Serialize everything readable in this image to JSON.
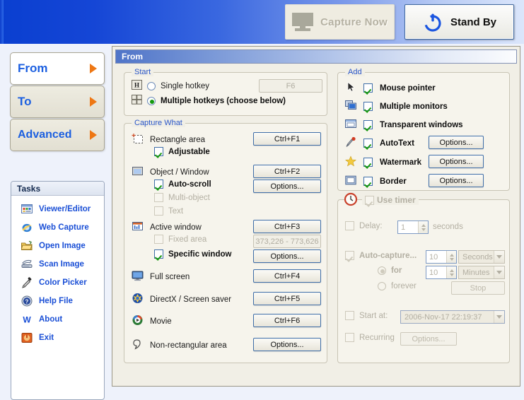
{
  "banner": {
    "capture_now_label": "Capture Now",
    "capture_now_icon": "monitor-icon",
    "capture_now_enabled": false,
    "stand_by_label": "Stand By",
    "stand_by_icon": "power-icon"
  },
  "sidebar": {
    "nav": [
      {
        "label": "From",
        "selected": true,
        "arrow_icon": "arrow-right-icon"
      },
      {
        "label": "To",
        "selected": false,
        "arrow_icon": "arrow-right-icon"
      },
      {
        "label": "Advanced",
        "selected": false,
        "arrow_icon": "arrow-right-icon"
      }
    ],
    "tasks_title": "Tasks",
    "tasks": [
      {
        "label": "Viewer/Editor",
        "icon": "viewer-editor-icon"
      },
      {
        "label": "Web Capture",
        "icon": "internet-explorer-icon"
      },
      {
        "label": "Open Image",
        "icon": "open-folder-icon"
      },
      {
        "label": "Scan Image",
        "icon": "scanner-icon"
      },
      {
        "label": "Color Picker",
        "icon": "eyedropper-icon"
      },
      {
        "label": "Help File",
        "icon": "help-question-icon"
      },
      {
        "label": "About",
        "icon": "letter-w-icon"
      },
      {
        "label": "Exit",
        "icon": "exit-icon"
      }
    ]
  },
  "main": {
    "header_title": "From",
    "start": {
      "legend": "Start",
      "single_hotkey_label": "Single hotkey",
      "single_hotkey_icon": "hotkey-h-icon",
      "single_hotkey_selected": false,
      "single_hotkey_value": "F6",
      "multiple_hotkeys_label": "Multiple hotkeys  (choose below)",
      "multiple_hotkeys_icon": "hotkey-grid-icon",
      "multiple_hotkeys_selected": true
    },
    "capture_what": {
      "legend": "Capture What",
      "items": [
        {
          "label": "Rectangle area",
          "icon": "rectangle-area-icon",
          "button": "Ctrl+F1"
        },
        {
          "label": "Object / Window",
          "icon": "object-window-icon",
          "button": "Ctrl+F2",
          "button2": "Options..."
        },
        {
          "label": "Active window",
          "icon": "active-window-icon",
          "button": "Ctrl+F3",
          "button2": "Options..."
        },
        {
          "label": "Full screen",
          "icon": "full-screen-icon",
          "button": "Ctrl+F4"
        },
        {
          "label": "DirectX / Screen saver",
          "icon": "directx-icon",
          "button": "Ctrl+F5"
        },
        {
          "label": "Movie",
          "icon": "movie-icon",
          "button": "Ctrl+F6"
        },
        {
          "label": "Non-rectangular area",
          "icon": "non-rectangular-icon",
          "button": "Options..."
        }
      ],
      "adjustable_label": "Adjustable",
      "adjustable_checked": true,
      "auto_scroll_label": "Auto-scroll",
      "auto_scroll_checked": true,
      "multi_object_label": "Multi-object",
      "multi_object_checked": false,
      "multi_object_enabled": false,
      "text_label": "Text",
      "text_checked": false,
      "text_enabled": false,
      "fixed_area_label": "Fixed area",
      "fixed_area_checked": false,
      "fixed_area_enabled": false,
      "fixed_area_value": "373,226 - 773,626",
      "specific_window_label": "Specific window",
      "specific_window_checked": true
    },
    "add": {
      "legend": "Add",
      "items": [
        {
          "label": "Mouse pointer",
          "icon": "mouse-pointer-icon",
          "checked": true
        },
        {
          "label": "Multiple monitors",
          "icon": "multiple-monitors-icon",
          "checked": true
        },
        {
          "label": "Transparent windows",
          "icon": "transparent-window-icon",
          "checked": true
        },
        {
          "label": "AutoText",
          "icon": "autotext-stamp-icon",
          "checked": true,
          "button": "Options..."
        },
        {
          "label": "Watermark",
          "icon": "star-icon",
          "checked": true,
          "button": "Options..."
        },
        {
          "label": "Border",
          "icon": "border-square-icon",
          "checked": true,
          "button": "Options..."
        }
      ]
    },
    "timer": {
      "legend": "Use timer",
      "legend_icon": "clock-icon",
      "legend_checked": true,
      "enabled": false,
      "delay_label": "Delay:",
      "delay_checked": false,
      "delay_value": "1",
      "delay_unit": "seconds",
      "auto_capture_label": "Auto-capture...",
      "auto_capture_checked": true,
      "auto_capture_value": "10",
      "auto_capture_unit": "Seconds",
      "for_label": "for",
      "for_selected": true,
      "for_value": "10",
      "for_unit": "Minutes",
      "forever_label": "forever",
      "forever_selected": false,
      "stop_label": "Stop",
      "start_at_label": "Start at:",
      "start_at_checked": false,
      "start_at_value": "2006-Nov-17 22:19:37",
      "recurring_label": "Recurring",
      "recurring_checked": false,
      "recurring_button": "Options..."
    }
  },
  "colors": {
    "banner_blue": "#1546d6",
    "accent_orange": "#ee7714",
    "link_blue": "#1a4fd6",
    "panel_bg": "#f1efe6",
    "check_green": "#17980f"
  }
}
